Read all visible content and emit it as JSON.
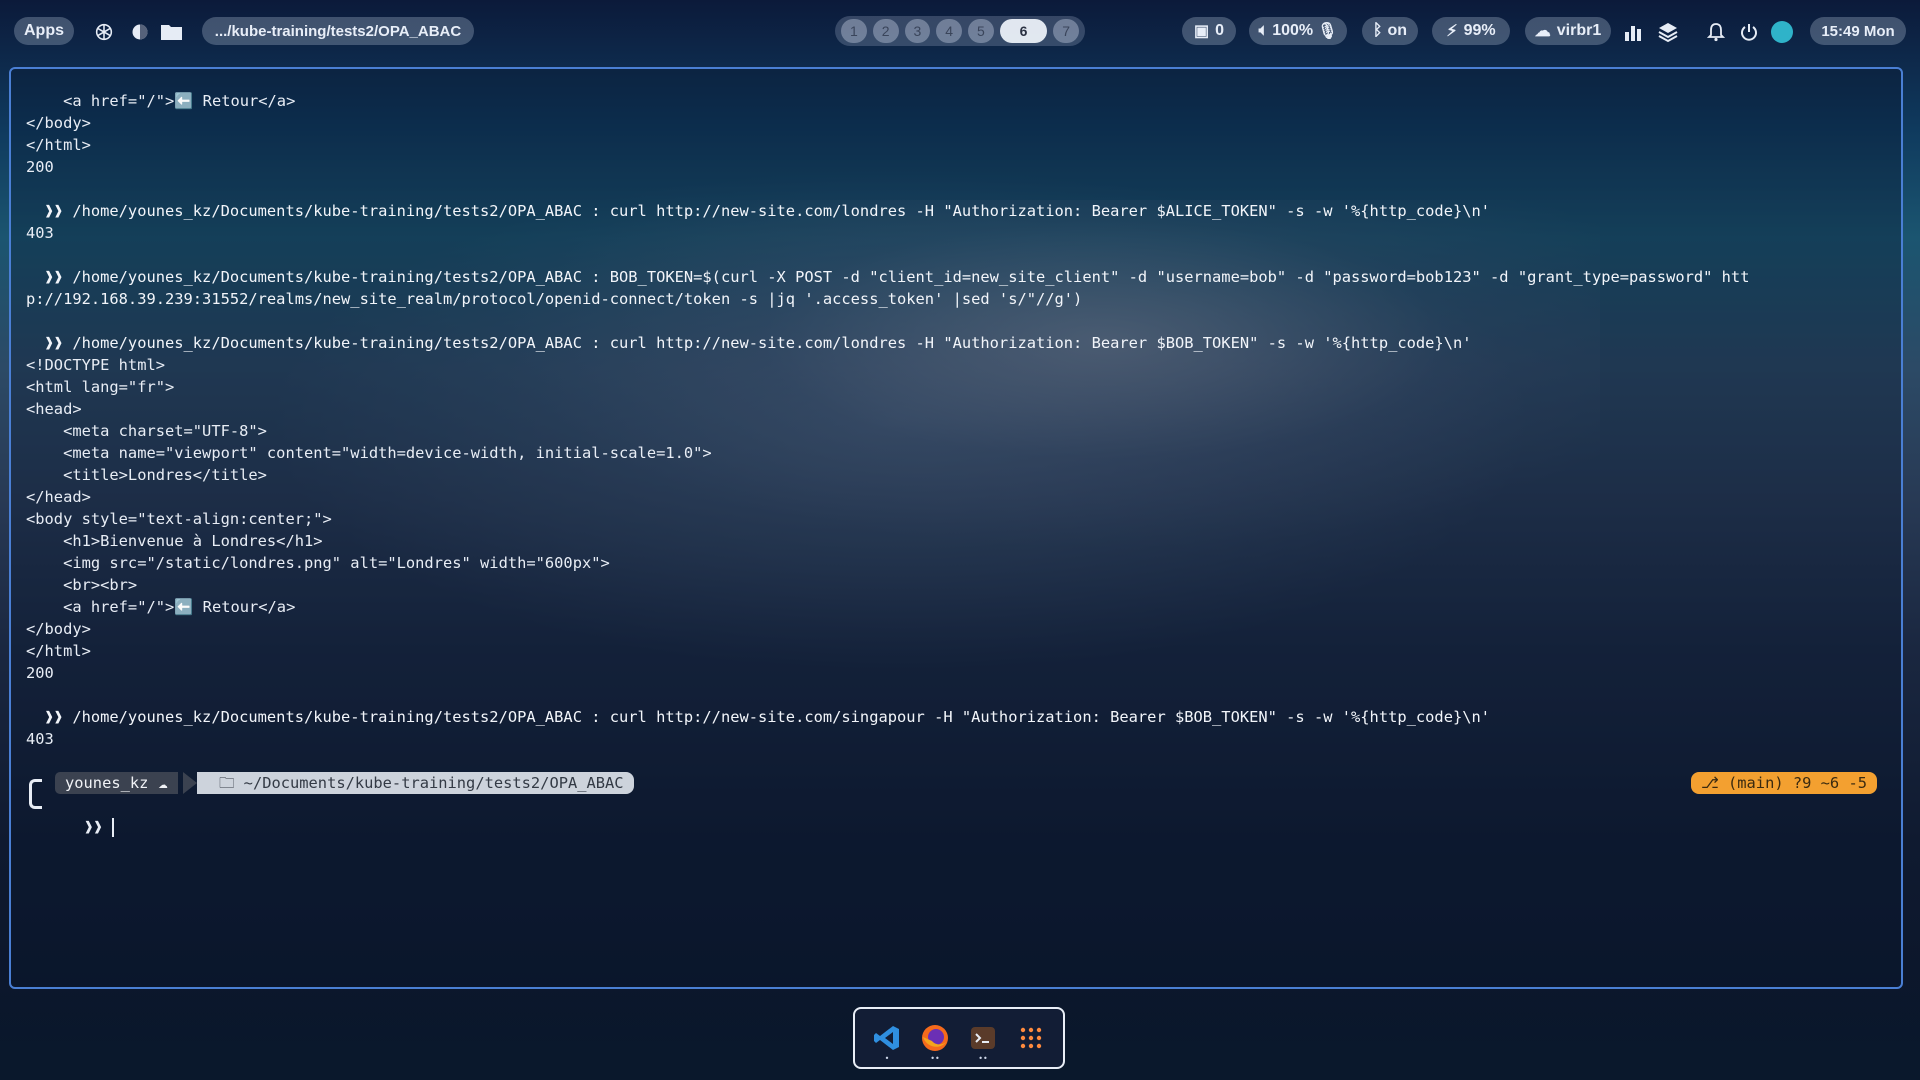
{
  "topbar": {
    "apps_label": "Apps",
    "current_path": ".../kube-training/tests2/OPA_ABAC",
    "workspaces": [
      "1",
      "2",
      "3",
      "4",
      "5",
      "6",
      "7"
    ],
    "active_workspace": "6",
    "containers_count": "0",
    "volume": "100%",
    "bluetooth": "on",
    "battery": "99%",
    "network": "virbr1",
    "clock": "15:49 Mon"
  },
  "terminal": {
    "lines": [
      {
        "t": "    <a href=\"/\">⬅️ Retour</a>"
      },
      {
        "t": "</body>"
      },
      {
        "t": "</html>"
      },
      {
        "t": "200"
      },
      {
        "t": ""
      },
      {
        "t": "  ❱❱ /home/younes_kz/Documents/kube-training/tests2/OPA_ABAC : curl http://new-site.com/londres -H \"Authorization: Bearer $ALICE_TOKEN\" -s -w '%{http_code}\\n'"
      },
      {
        "t": "403"
      },
      {
        "t": ""
      },
      {
        "t": "  ❱❱ /home/younes_kz/Documents/kube-training/tests2/OPA_ABAC : BOB_TOKEN=$(curl -X POST -d \"client_id=new_site_client\" -d \"username=bob\" -d \"password=bob123\" -d \"grant_type=password\" htt"
      },
      {
        "t": "p://192.168.39.239:31552/realms/new_site_realm/protocol/openid-connect/token -s |jq '.access_token' |sed 's/\"//g')"
      },
      {
        "t": ""
      },
      {
        "t": "  ❱❱ /home/younes_kz/Documents/kube-training/tests2/OPA_ABAC : curl http://new-site.com/londres -H \"Authorization: Bearer $BOB_TOKEN\" -s -w '%{http_code}\\n'"
      },
      {
        "t": "<!DOCTYPE html>"
      },
      {
        "t": "<html lang=\"fr\">"
      },
      {
        "t": "<head>"
      },
      {
        "t": "    <meta charset=\"UTF-8\">"
      },
      {
        "t": "    <meta name=\"viewport\" content=\"width=device-width, initial-scale=1.0\">"
      },
      {
        "t": "    <title>Londres</title>"
      },
      {
        "t": "</head>"
      },
      {
        "t": "<body style=\"text-align:center;\">"
      },
      {
        "t": "    <h1>Bienvenue à Londres</h1>"
      },
      {
        "t": "    <img src=\"/static/londres.png\" alt=\"Londres\" width=\"600px\">"
      },
      {
        "t": "    <br><br>"
      },
      {
        "t": "    <a href=\"/\">⬅️ Retour</a>"
      },
      {
        "t": "</body>"
      },
      {
        "t": "</html>"
      },
      {
        "t": "200"
      },
      {
        "t": ""
      },
      {
        "t": "  ❱❱ /home/younes_kz/Documents/kube-training/tests2/OPA_ABAC : curl http://new-site.com/singapour -H \"Authorization: Bearer $BOB_TOKEN\" -s -w '%{http_code}\\n'"
      },
      {
        "t": "403"
      }
    ],
    "prompt": {
      "user": "younes_kz",
      "dir": "~/Documents/kube-training/tests2/OPA_ABAC",
      "git": "(main) ?9 ~6 -5",
      "symbol": "❱❱"
    }
  },
  "dock": {
    "apps": [
      {
        "name": "vscode-icon"
      },
      {
        "name": "firefox-icon"
      },
      {
        "name": "terminal-icon"
      },
      {
        "name": "app-grid-icon"
      }
    ]
  },
  "colors": {
    "accent": "#4a7fd4",
    "git_pill": "#f3a030",
    "prompt_dark": "#3b4250",
    "prompt_light": "#cdd3dc"
  }
}
